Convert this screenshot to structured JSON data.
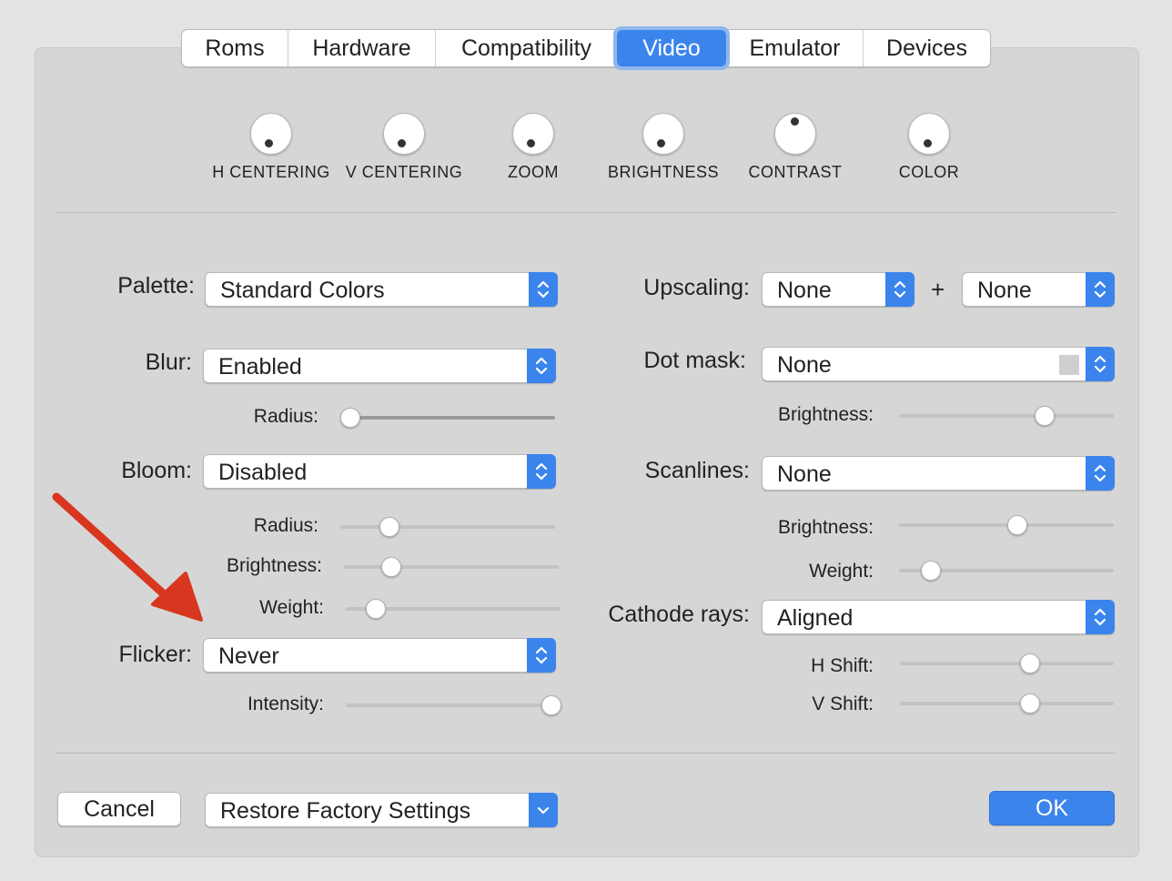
{
  "tabs": [
    "Roms",
    "Hardware",
    "Compatibility",
    "Video",
    "Emulator",
    "Devices"
  ],
  "active_tab": "Video",
  "knobs": [
    {
      "label": "H CENTERING"
    },
    {
      "label": "V CENTERING"
    },
    {
      "label": "ZOOM"
    },
    {
      "label": "BRIGHTNESS"
    },
    {
      "label": "CONTRAST"
    },
    {
      "label": "COLOR"
    }
  ],
  "left": {
    "palette": {
      "label": "Palette:",
      "value": "Standard Colors"
    },
    "blur": {
      "label": "Blur:",
      "value": "Enabled",
      "radius_label": "Radius:",
      "radius": 0.0
    },
    "bloom": {
      "label": "Bloom:",
      "value": "Disabled",
      "radius_label": "Radius:",
      "radius": 0.23,
      "brightness_label": "Brightness:",
      "brightness": 0.22,
      "weight_label": "Weight:",
      "weight": 0.14
    },
    "flicker": {
      "label": "Flicker:",
      "value": "Never",
      "intensity_label": "Intensity:",
      "intensity": 1.0
    }
  },
  "right": {
    "upscaling": {
      "label": "Upscaling:",
      "value1": "None",
      "plus": "+",
      "value2": "None"
    },
    "dotmask": {
      "label": "Dot mask:",
      "value": "None",
      "brightness_label": "Brightness:",
      "brightness": 0.68
    },
    "scanlines": {
      "label": "Scanlines:",
      "value": "None",
      "brightness_label": "Brightness:",
      "brightness": 0.55,
      "weight_label": "Weight:",
      "weight": 0.15
    },
    "cathode": {
      "label": "Cathode rays:",
      "value": "Aligned",
      "hshift_label": "H Shift:",
      "hshift": 0.61,
      "vshift_label": "V Shift:",
      "vshift": 0.61
    }
  },
  "footer": {
    "cancel": "Cancel",
    "restore": "Restore Factory Settings",
    "ok": "OK"
  },
  "colors": {
    "accent": "#3b84ec",
    "annotation": "#d9361f"
  },
  "icons": {
    "popup": "chevron-up-down-icon",
    "annotation": "red-arrow"
  }
}
